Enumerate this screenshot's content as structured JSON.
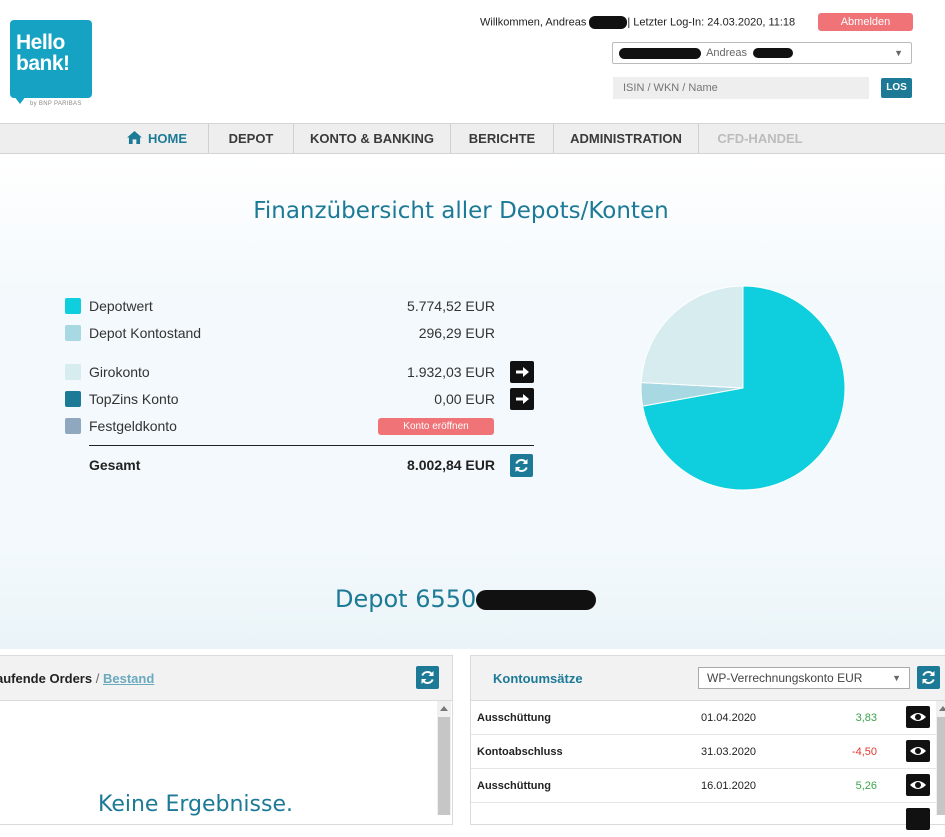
{
  "header": {
    "logo_line1": "Hello",
    "logo_line2": "bank!",
    "logo_sub": "by BNP PARIBAS",
    "welcome_prefix": "Willkommen, Andreas",
    "last_login": "| Letzter Log-In: 24.03.2020, 11:18",
    "logout_label": "Abmelden",
    "account_select_value": "Andreas",
    "search_placeholder": "ISIN / WKN / Name",
    "search_button": "LOS"
  },
  "nav": {
    "items": [
      {
        "label": "HOME",
        "state": "active",
        "icon": "home-icon"
      },
      {
        "label": "DEPOT",
        "state": "normal"
      },
      {
        "label": "KONTO & BANKING",
        "state": "normal"
      },
      {
        "label": "BERICHTE",
        "state": "normal"
      },
      {
        "label": "ADMINISTRATION",
        "state": "normal"
      },
      {
        "label": "CFD-HANDEL",
        "state": "disabled"
      }
    ]
  },
  "overview": {
    "title": "Finanzübersicht aller Depots/Konten",
    "rows": [
      {
        "label": "Depotwert",
        "value": "5.774,52 EUR",
        "color": "#0fcfdf",
        "action": "none"
      },
      {
        "label": "Depot Kontostand",
        "value": "296,29 EUR",
        "color": "#a8d8e2",
        "action": "none"
      },
      {
        "label": "Girokonto",
        "value": "1.932,03 EUR",
        "color": "#d6ecef",
        "action": "arrow"
      },
      {
        "label": "TopZins Konto",
        "value": "0,00 EUR",
        "color": "#1d7a97",
        "action": "arrow"
      },
      {
        "label": "Festgeldkonto",
        "value": "",
        "color": "#8fa8c0",
        "action": "open"
      }
    ],
    "open_account_label": "Konto eröffnen",
    "total_label": "Gesamt",
    "total_value": "8.002,84 EUR"
  },
  "chart_data": {
    "type": "pie",
    "slices": [
      {
        "label": "Depotwert",
        "value": 5774.52,
        "color": "#0fcfdf"
      },
      {
        "label": "Depot Kontostand",
        "value": 296.29,
        "color": "#a8d8e2"
      },
      {
        "label": "Girokonto",
        "value": 1932.03,
        "color": "#d6ecef"
      },
      {
        "label": "TopZins Konto",
        "value": 0.0,
        "color": "#1d7a97"
      }
    ],
    "title": ""
  },
  "depot": {
    "title": "Depot 6550"
  },
  "orders_panel": {
    "tab_orders": "aufende Orders",
    "separator": "/",
    "tab_bestand": "Bestand",
    "empty_message": "Keine Ergebnisse."
  },
  "konto_panel": {
    "title": "Kontoumsätze",
    "select_value": "WP-Verrechnungskonto EUR",
    "transactions": [
      {
        "name": "Ausschüttung",
        "date": "01.04.2020",
        "amount": "3,83",
        "sign": "pos"
      },
      {
        "name": "Kontoabschluss",
        "date": "31.03.2020",
        "amount": "-4,50",
        "sign": "neg"
      },
      {
        "name": "Ausschüttung",
        "date": "16.01.2020",
        "amount": "5,26",
        "sign": "pos"
      }
    ]
  },
  "colors": {
    "accent": "#1d7a97",
    "logo": "#16a2c2",
    "logout": "#f07377"
  }
}
